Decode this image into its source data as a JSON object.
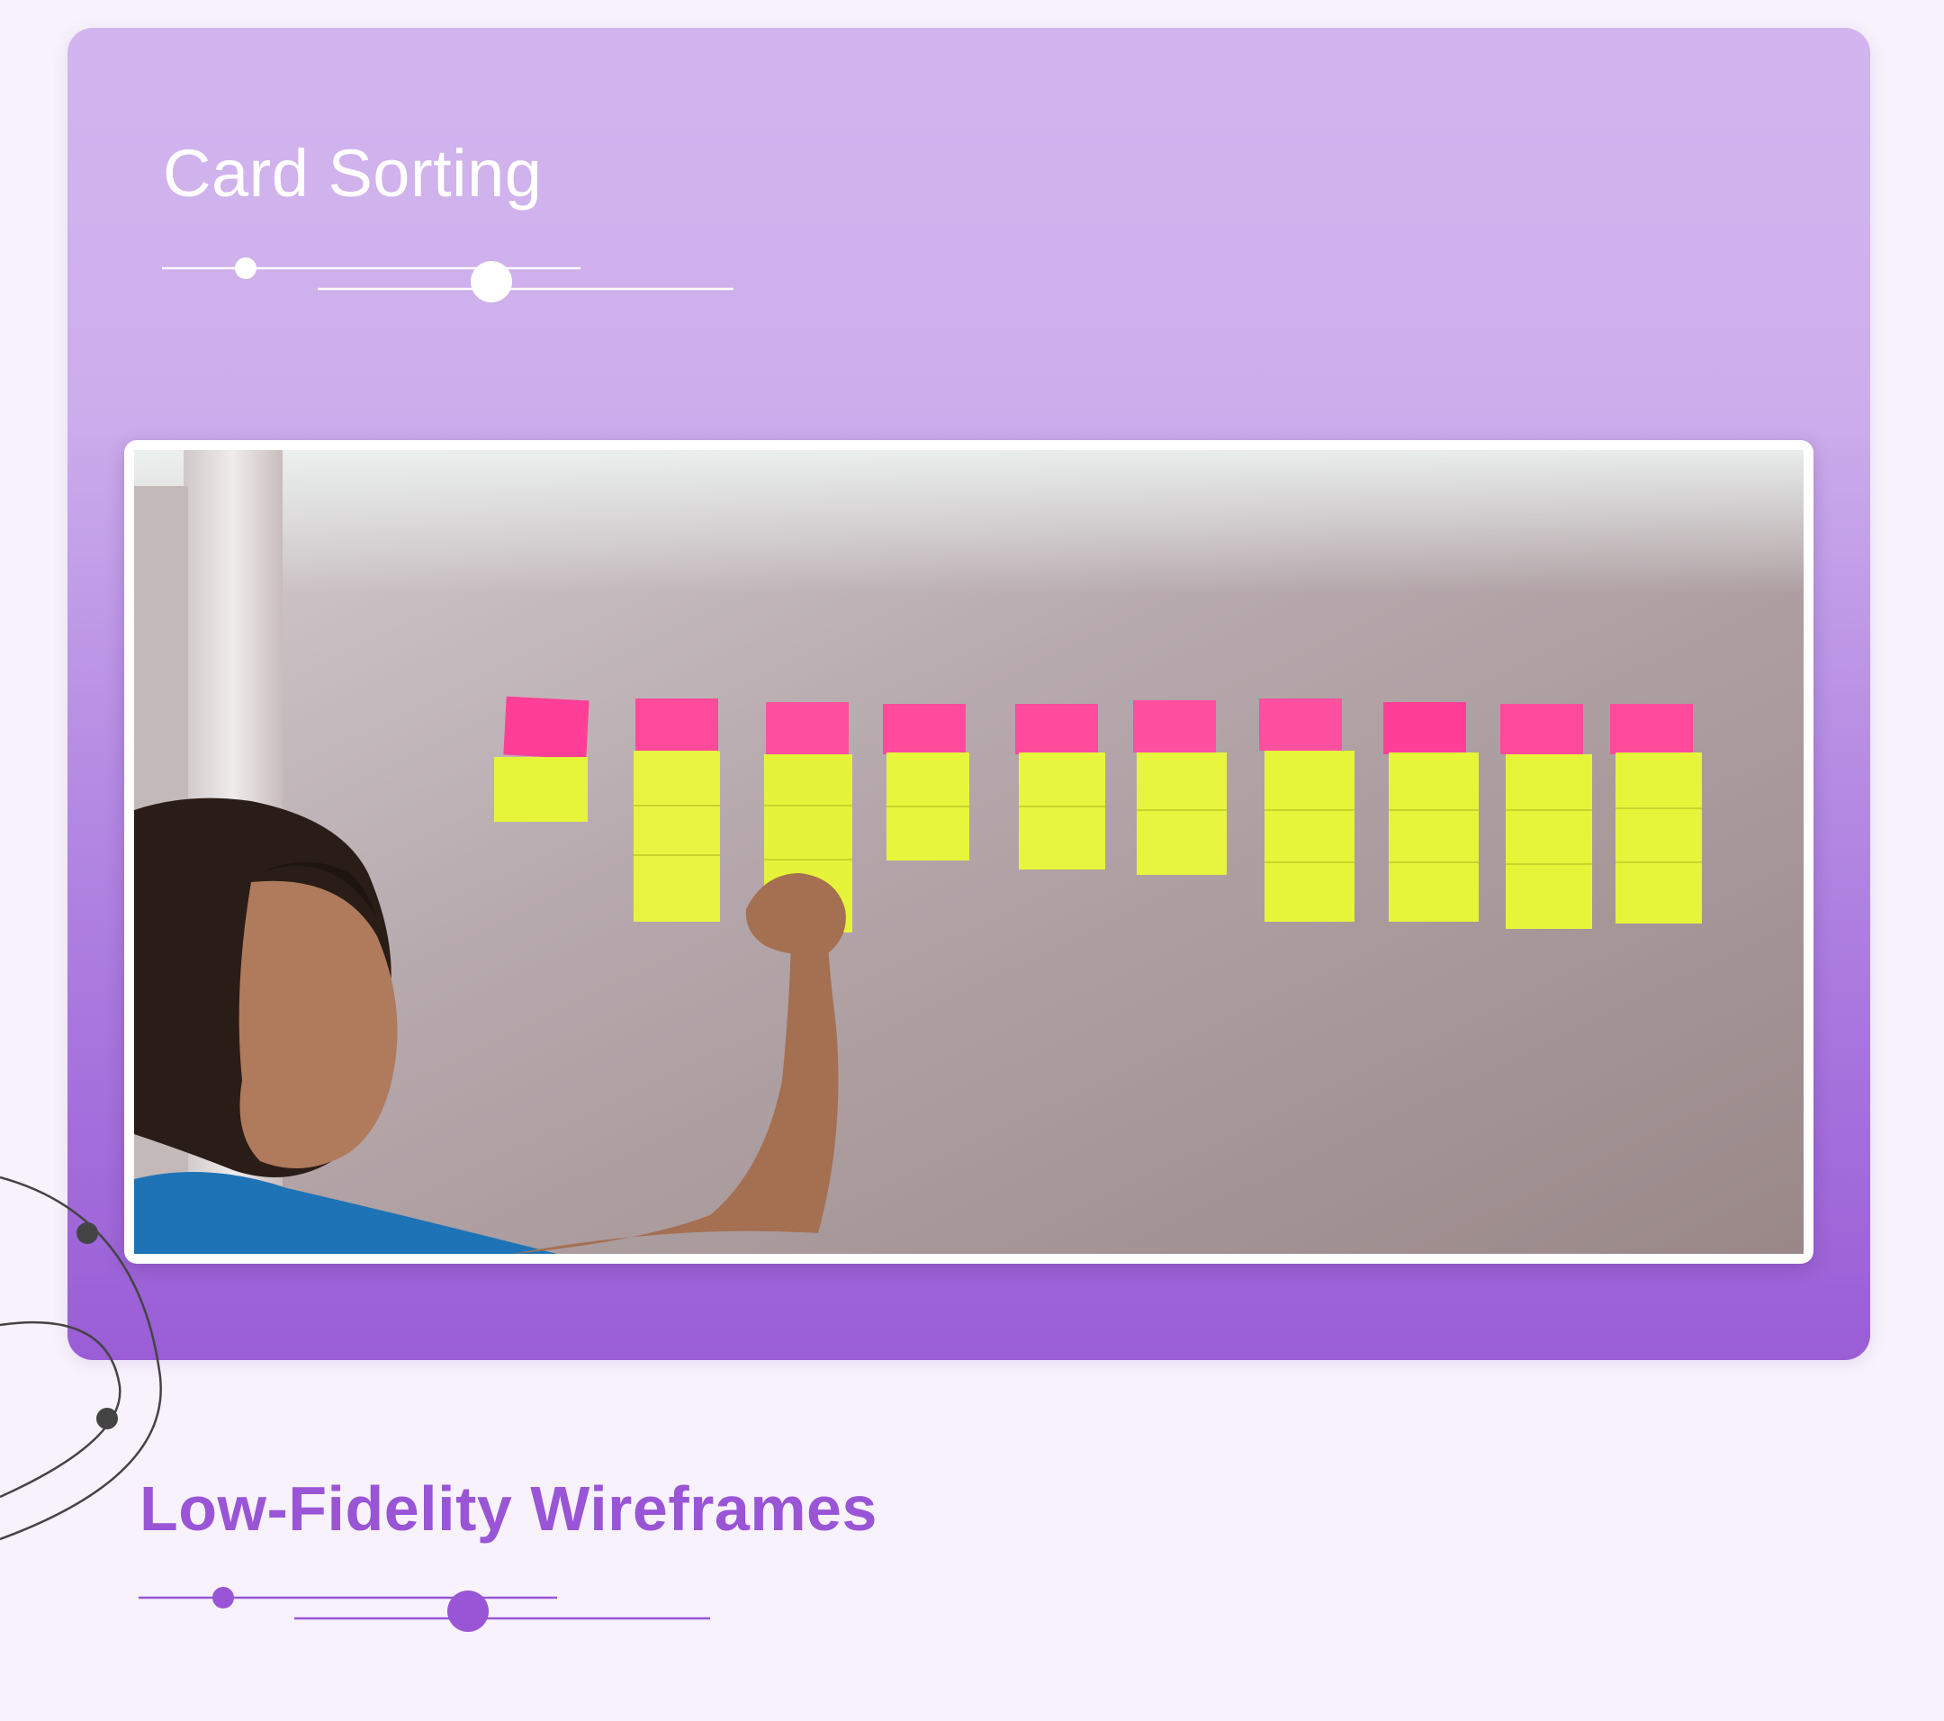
{
  "sections": {
    "card_sorting_title": "Card Sorting",
    "wireframes_title": "Low-Fidelity Wireframes"
  },
  "photo": {
    "description_icon": "card-sorting-photo",
    "header_notes_count": 10
  },
  "colors": {
    "accent_purple": "#9a55d6",
    "card_top": "#d2b5ee",
    "card_bottom": "#9a5dd6",
    "sticky_pink": "#ff4fa3",
    "sticky_yellow": "#e9f53a",
    "background": "#f7f2fc"
  },
  "icons": {
    "slider_top": "slider-deco-icon",
    "slider_bottom": "slider-deco-icon",
    "orbit": "orbit-deco-icon"
  }
}
